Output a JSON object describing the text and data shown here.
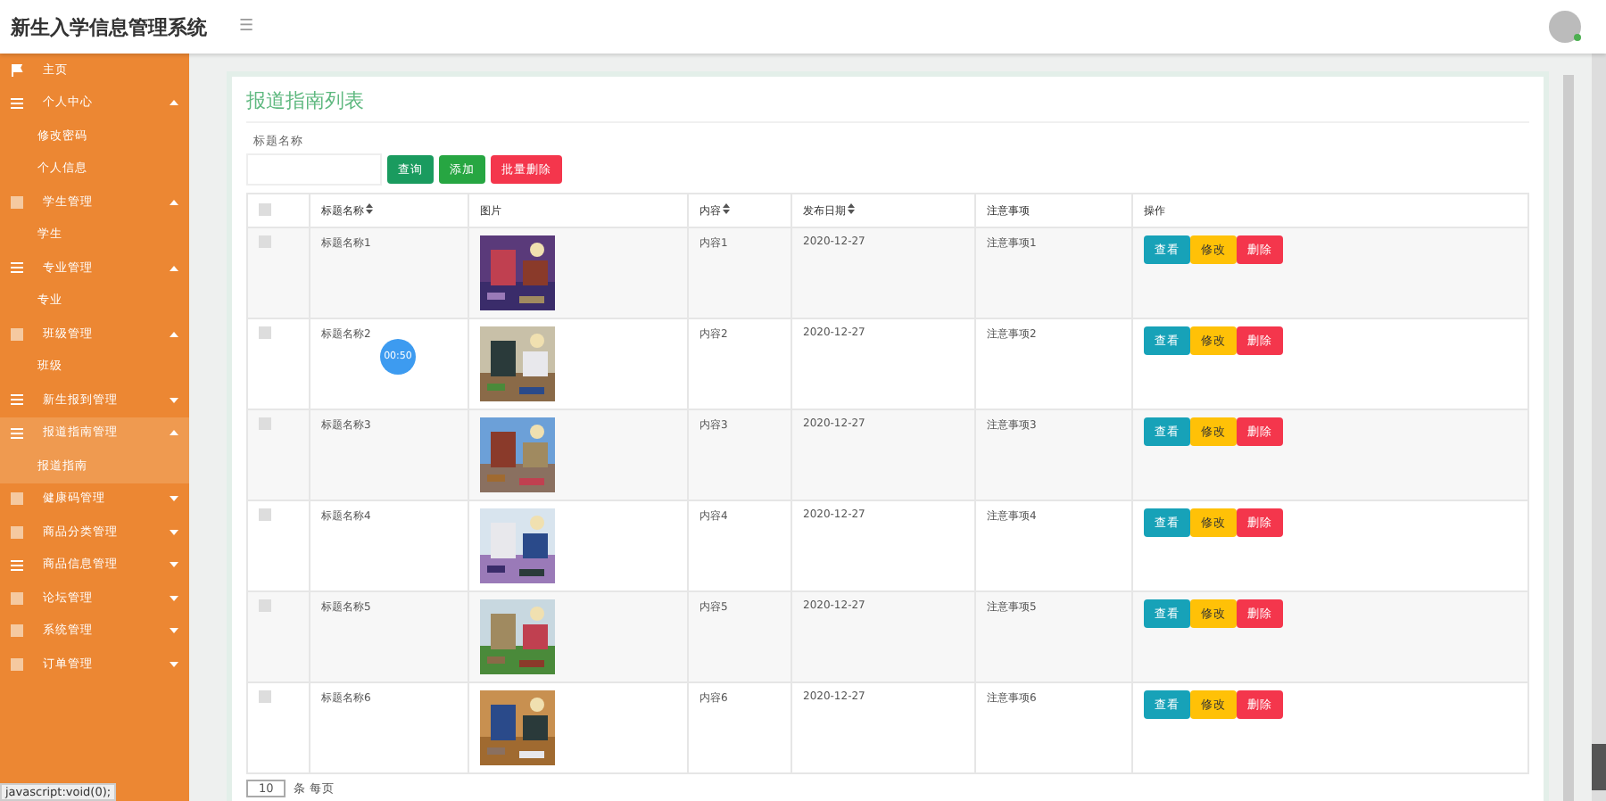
{
  "header": {
    "title": "新生入学信息管理系统",
    "menu_icon": "☰"
  },
  "sidebar": {
    "items": [
      {
        "label": "主页",
        "selected": false
      },
      {
        "label": "个人中心",
        "expanded": true,
        "selected": false,
        "children": [
          {
            "label": "修改密码",
            "selected": false
          },
          {
            "label": "个人信息",
            "selected": false
          }
        ]
      },
      {
        "label": "学生管理",
        "expanded": true,
        "selected": false,
        "children": [
          {
            "label": "学生",
            "selected": false
          }
        ]
      },
      {
        "label": "专业管理",
        "expanded": true,
        "selected": false,
        "children": [
          {
            "label": "专业",
            "selected": false
          }
        ]
      },
      {
        "label": "班级管理",
        "expanded": true,
        "selected": false,
        "children": [
          {
            "label": "班级",
            "selected": false
          }
        ]
      },
      {
        "label": "新生报到管理",
        "expanded": false,
        "selected": false
      },
      {
        "label": "报道指南管理",
        "expanded": true,
        "selected": true,
        "children": [
          {
            "label": "报道指南",
            "selected": true
          }
        ]
      },
      {
        "label": "健康码管理",
        "expanded": false,
        "selected": false
      },
      {
        "label": "商品分类管理",
        "expanded": false,
        "selected": false
      },
      {
        "label": "商品信息管理",
        "expanded": false,
        "selected": false
      },
      {
        "label": "论坛管理",
        "expanded": false,
        "selected": false
      },
      {
        "label": "系统管理",
        "expanded": false,
        "selected": false
      },
      {
        "label": "订单管理",
        "expanded": false,
        "selected": false
      }
    ]
  },
  "panel": {
    "title": "报道指南列表",
    "search_label": "标题名称",
    "buttons": [
      {
        "label": "查询",
        "kind": "search"
      },
      {
        "label": "添加",
        "kind": "add"
      },
      {
        "label": "批量删除",
        "kind": "delete"
      }
    ]
  },
  "table": {
    "columns": [
      {
        "kind": "checkbox",
        "checked": false,
        "sortable": false
      },
      {
        "label": "标题名称",
        "sortable": true
      },
      {
        "label": "图片",
        "sortable": false
      },
      {
        "label": "内容",
        "sortable": true
      },
      {
        "label": "发布日期",
        "sortable": true
      },
      {
        "label": "注意事项",
        "sortable": false
      },
      {
        "label": "操作",
        "sortable": false
      }
    ],
    "rows": [
      {
        "checked": false,
        "title": "标题名称1",
        "content": "内容1",
        "date": "2020-12-27",
        "notes": "注意事项1",
        "actions": [
          {
            "label": "查看",
            "kind": "view"
          },
          {
            "label": "修改",
            "kind": "edit"
          },
          {
            "label": "删除",
            "kind": "delete"
          }
        ]
      },
      {
        "checked": false,
        "title": "标题名称2",
        "content": "内容2",
        "date": "2020-12-27",
        "notes": "注意事项2",
        "actions": [
          {
            "label": "查看",
            "kind": "view"
          },
          {
            "label": "修改",
            "kind": "edit"
          },
          {
            "label": "删除",
            "kind": "delete"
          }
        ]
      },
      {
        "checked": false,
        "title": "标题名称3",
        "content": "内容3",
        "date": "2020-12-27",
        "notes": "注意事项3",
        "actions": [
          {
            "label": "查看",
            "kind": "view"
          },
          {
            "label": "修改",
            "kind": "edit"
          },
          {
            "label": "删除",
            "kind": "delete"
          }
        ]
      },
      {
        "checked": false,
        "title": "标题名称4",
        "content": "内容4",
        "date": "2020-12-27",
        "notes": "注意事项4",
        "actions": [
          {
            "label": "查看",
            "kind": "view"
          },
          {
            "label": "修改",
            "kind": "edit"
          },
          {
            "label": "删除",
            "kind": "delete"
          }
        ]
      },
      {
        "checked": false,
        "title": "标题名称5",
        "content": "内容5",
        "date": "2020-12-27",
        "notes": "注意事项5",
        "actions": [
          {
            "label": "查看",
            "kind": "view"
          },
          {
            "label": "修改",
            "kind": "edit"
          },
          {
            "label": "删除",
            "kind": "delete"
          }
        ]
      },
      {
        "checked": false,
        "title": "标题名称6",
        "content": "内容6",
        "date": "2020-12-27",
        "notes": "注意事项6",
        "actions": [
          {
            "label": "查看",
            "kind": "view"
          },
          {
            "label": "修改",
            "kind": "edit"
          },
          {
            "label": "删除",
            "kind": "delete"
          }
        ]
      }
    ]
  },
  "pagination": {
    "page_size": "10",
    "suffix": "条 每页"
  },
  "timer": "00:50",
  "status_bar": "javascript:void(0);"
}
